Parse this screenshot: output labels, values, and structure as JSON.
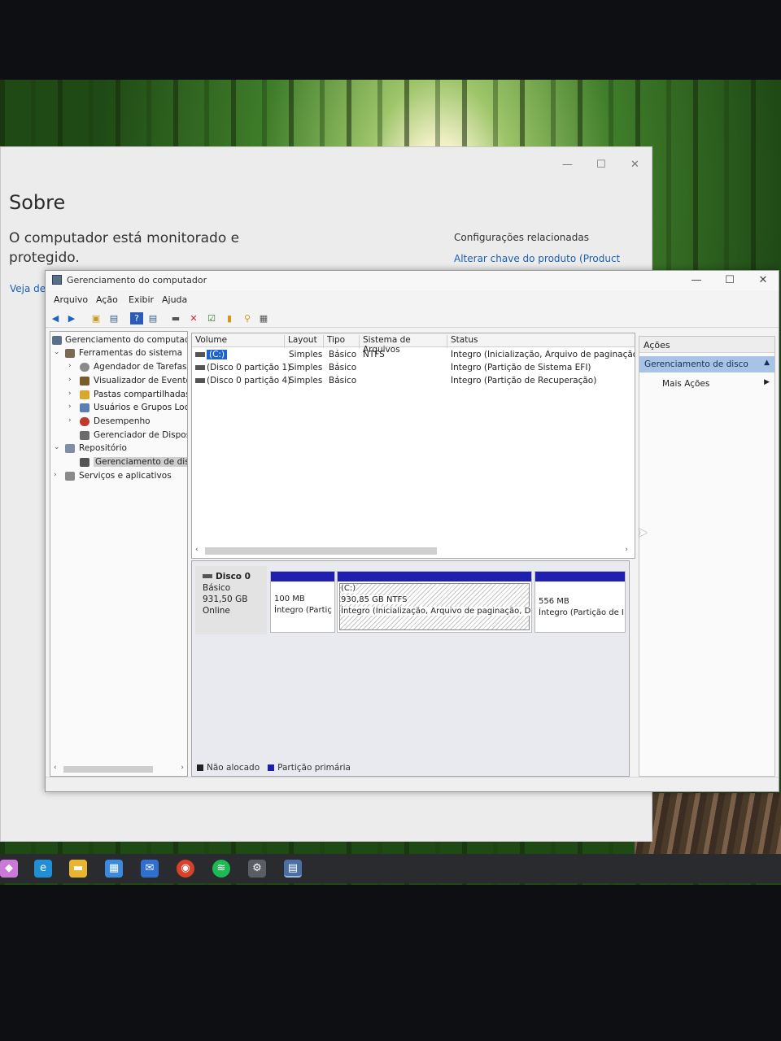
{
  "settings": {
    "title": "Sobre",
    "status_text": "O computador está monitorado e protegido.",
    "related_title": "Configurações relacionadas",
    "related_link": "Alterar chave do produto (Product",
    "veja": "Veja de"
  },
  "window": {
    "title": "Gerenciamento do computador",
    "minimize": "—",
    "maximize": "☐",
    "close": "✕"
  },
  "menu": [
    "Arquivo",
    "Ação",
    "Exibir",
    "Ajuda"
  ],
  "tree": {
    "root": "Gerenciamento do computado",
    "items": [
      {
        "label": "Ferramentas do sistema",
        "level": 1,
        "arrow": "⌄",
        "color": "#7a6a52"
      },
      {
        "label": "Agendador de Tarefas",
        "level": 2,
        "arrow": "›",
        "color": "#8a8a8a"
      },
      {
        "label": "Visualizador de Eventos",
        "level": 2,
        "arrow": "›",
        "color": "#7a5a2a"
      },
      {
        "label": "Pastas compartilhadas",
        "level": 2,
        "arrow": "›",
        "color": "#d9a72a"
      },
      {
        "label": "Usuários e Grupos Loca",
        "level": 2,
        "arrow": "›",
        "color": "#5b7fb3"
      },
      {
        "label": "Desempenho",
        "level": 2,
        "arrow": "›",
        "color": "#c0392b"
      },
      {
        "label": "Gerenciador de Disposit",
        "level": 2,
        "arrow": "",
        "color": "#6b6b6b"
      },
      {
        "label": "Repositório",
        "level": 1,
        "arrow": "⌄",
        "color": "#7f8ea3"
      },
      {
        "label": "Gerenciamento de disco",
        "level": 2,
        "arrow": "",
        "color": "#555555",
        "selected": true
      },
      {
        "label": "Serviços e aplicativos",
        "level": 1,
        "arrow": "›",
        "color": "#8a8a8a"
      }
    ]
  },
  "volumes": {
    "columns": [
      "Volume",
      "Layout",
      "Tipo",
      "Sistema de Arquivos",
      "Status"
    ],
    "rows": [
      {
        "volume": "(C:)",
        "layout": "Simples",
        "tipo": "Básico",
        "fs": "NTFS",
        "status": "Íntegro (Inicialização, Arquivo de paginação, D"
      },
      {
        "volume": "(Disco 0 partição 1)",
        "layout": "Simples",
        "tipo": "Básico",
        "fs": "",
        "status": "Íntegro (Partição de Sistema EFI)"
      },
      {
        "volume": "(Disco 0 partição 4)",
        "layout": "Simples",
        "tipo": "Básico",
        "fs": "",
        "status": "Íntegro (Partição de Recuperação)"
      }
    ]
  },
  "disk": {
    "name": "Disco 0",
    "type": "Básico",
    "size": "931,50 GB",
    "state": "Online",
    "partitions": [
      {
        "line1": "100 MB",
        "line2": "Íntegro (Partiç"
      },
      {
        "line0": "(C:)",
        "line1": "930,85 GB NTFS",
        "line2": "Íntegro (Inicialização, Arquivo de paginação, Des"
      },
      {
        "line1": "556 MB",
        "line2": "Íntegro (Partição de I"
      }
    ]
  },
  "legend": {
    "unallocated": "Não alocado",
    "primary": "Partição primária",
    "unallocated_color": "#222222",
    "primary_color": "#1f1fb0"
  },
  "actions": {
    "title": "Ações",
    "section": "Gerenciamento de disco",
    "more": "Mais Ações"
  },
  "taskbar": [
    {
      "name": "windows-icon",
      "glyph": "◆",
      "color": "#c97ad6"
    },
    {
      "name": "edge-icon",
      "glyph": "e",
      "color": "#1f8fd6"
    },
    {
      "name": "explorer-icon",
      "glyph": "▬",
      "color": "#e8b531"
    },
    {
      "name": "store-icon",
      "glyph": "▦",
      "color": "#3a8be0"
    },
    {
      "name": "mail-icon",
      "glyph": "✉",
      "color": "#2f6fcf"
    },
    {
      "name": "chrome-icon",
      "glyph": "◉",
      "color": "#d9412b"
    },
    {
      "name": "spotify-icon",
      "glyph": "≋",
      "color": "#1db954"
    },
    {
      "name": "settings-icon",
      "glyph": "⚙",
      "color": "#5a5d63"
    },
    {
      "name": "computer-management-icon",
      "glyph": "▤",
      "color": "#4a6fa5"
    }
  ]
}
